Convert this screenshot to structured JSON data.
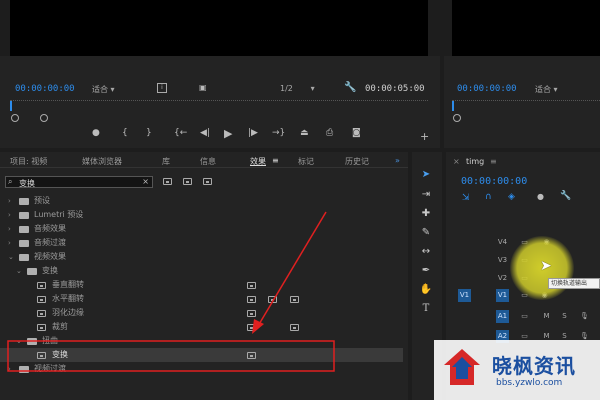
{
  "program_monitor": {
    "timecode_in": "00:00:00:00",
    "fit_label": "适合",
    "fraction": "1/2",
    "timecode_out": "00:00:05:00"
  },
  "source_monitor": {
    "timecode": "00:00:00:00",
    "fit_label": "适合"
  },
  "project_panel": {
    "tabs": [
      "项目: 视频",
      "媒体浏览器",
      "库",
      "信息",
      "效果",
      "标记",
      "历史记"
    ],
    "search_value": "变换",
    "tree": [
      {
        "label": "预设",
        "indent": 0
      },
      {
        "label": "Lumetri 预设",
        "indent": 0
      },
      {
        "label": "音频效果",
        "indent": 0
      },
      {
        "label": "音频过渡",
        "indent": 0
      },
      {
        "label": "视频效果",
        "indent": 0
      },
      {
        "label": "变换",
        "indent": 1
      },
      {
        "label": "垂直翻转",
        "indent": 2
      },
      {
        "label": "水平翻转",
        "indent": 2
      },
      {
        "label": "羽化边缘",
        "indent": 2
      },
      {
        "label": "裁剪",
        "indent": 2
      },
      {
        "label": "扭曲",
        "indent": 1
      },
      {
        "label": "变换",
        "indent": 2
      },
      {
        "label": "视频过渡",
        "indent": 0
      }
    ]
  },
  "timeline": {
    "tab": "timg",
    "timecode": "00:00:00:00",
    "tracks": [
      {
        "label": "V4"
      },
      {
        "label": "V3"
      },
      {
        "label": "V2"
      },
      {
        "label": "V1",
        "source": "V1"
      },
      {
        "label": "A1",
        "letters": [
          "M",
          "S"
        ]
      },
      {
        "label": "A2",
        "letters": [
          "M",
          "S"
        ]
      }
    ],
    "tooltip": "切换轨道输出"
  },
  "watermark": {
    "brand": "晓枫资讯",
    "url": "bbs.yzwlo.com"
  },
  "colors": {
    "accent": "#2d8ceb",
    "annotation": "#e02020",
    "cursor_highlight": "#d9d62b"
  }
}
